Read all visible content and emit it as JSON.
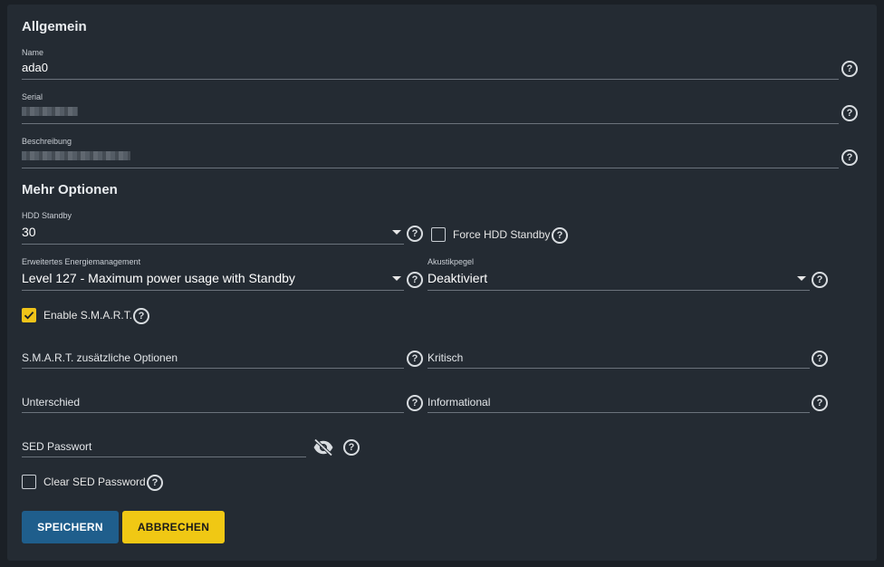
{
  "general": {
    "title": "Allgemein",
    "name": {
      "label": "Name",
      "value": "ada0"
    },
    "serial": {
      "label": "Serial"
    },
    "description": {
      "label": "Beschreibung"
    }
  },
  "more": {
    "title": "Mehr Optionen",
    "hdd_standby": {
      "label": "HDD Standby",
      "value": "30"
    },
    "force_hdd_standby": {
      "label": "Force HDD Standby",
      "checked": false
    },
    "apm": {
      "label": "Erweitertes Energiemanagement",
      "value": "Level 127 - Maximum power usage with Standby"
    },
    "acoustic": {
      "label": "Akustikpegel",
      "value": "Deaktiviert"
    },
    "enable_smart": {
      "label": "Enable S.M.A.R.T.",
      "checked": true
    },
    "smart_options": {
      "placeholder": "S.M.A.R.T. zusätzliche Optionen"
    },
    "critical": {
      "placeholder": "Kritisch"
    },
    "difference": {
      "placeholder": "Unterschied"
    },
    "informational": {
      "placeholder": "Informational"
    },
    "sed_password": {
      "placeholder": "SED Passwort"
    },
    "clear_sed": {
      "label": "Clear SED Password",
      "checked": false
    }
  },
  "buttons": {
    "save": "SPEICHERN",
    "cancel": "ABBRECHEN"
  },
  "help_glyph": "?",
  "icons": {
    "help": "help-circle-icon",
    "caret": "caret-down-icon",
    "visibility": "eye-off-icon",
    "check": "check-icon"
  },
  "colors": {
    "background": "#1b2026",
    "card": "#242b33",
    "primary": "#1f5e8c",
    "accent": "#f0c814"
  }
}
